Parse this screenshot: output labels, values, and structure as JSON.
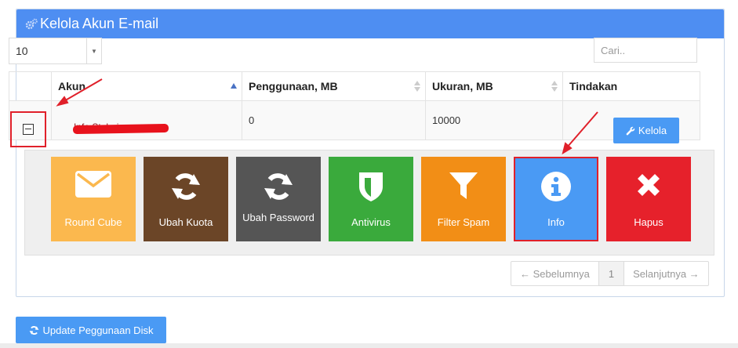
{
  "panel": {
    "title": "Kelola Akun E-mail"
  },
  "length_select": {
    "value": "10"
  },
  "search": {
    "placeholder": "Cari.."
  },
  "table": {
    "columns": [
      "Akun",
      "Penggunaan, MB",
      "Ukuran, MB",
      "Tindakan"
    ],
    "rows": [
      {
        "akun": "Info Stabai",
        "penggunaan": "0",
        "ukuran": "10000",
        "action_label": "Kelola"
      }
    ]
  },
  "actions": [
    {
      "label": "Round Cube",
      "icon": "envelope-icon",
      "color": "#fbb84e"
    },
    {
      "label": "Ubah Kuota",
      "icon": "refresh-icon",
      "color": "#6b4527"
    },
    {
      "label": "Ubah Password",
      "icon": "refresh-icon",
      "color": "#555555"
    },
    {
      "label": "Antivirus",
      "icon": "shield-icon",
      "color": "#3aaa3c"
    },
    {
      "label": "Filter Spam",
      "icon": "filter-icon",
      "color": "#f28e16"
    },
    {
      "label": "Info",
      "icon": "info-icon",
      "color": "#4a9af4"
    },
    {
      "label": "Hapus",
      "icon": "close-icon",
      "color": "#e6212b"
    }
  ],
  "pagination": {
    "prev": "← Sebelumnya",
    "page": "1",
    "next": "Selanjutnya →"
  },
  "update_button": {
    "label": "Update Peggunaan Disk"
  },
  "colors": {
    "primary": "#4e8ef2",
    "button": "#4a9af4",
    "highlight": "#e0202a"
  }
}
